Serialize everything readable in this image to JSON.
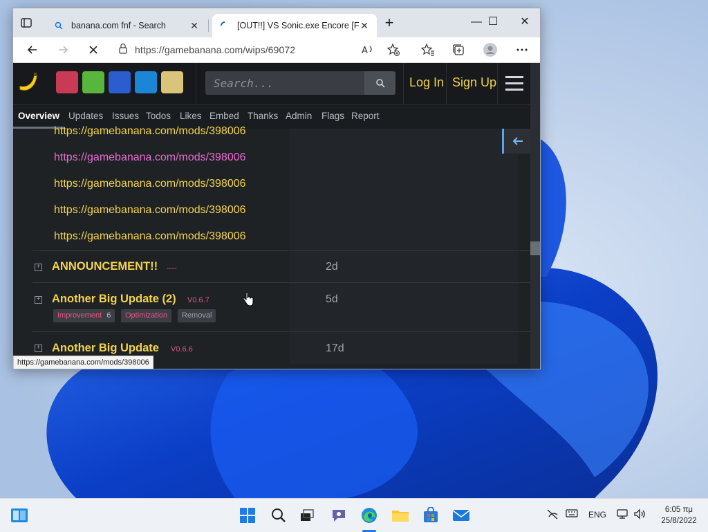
{
  "browser": {
    "tabs": [
      {
        "title": "banana.com fnf - Search",
        "favicon": "search-icon"
      },
      {
        "title": "[OUT!!] VS Sonic.exe Encore [FAN",
        "favicon": "loading-icon"
      }
    ],
    "address": "https://gamebanana.com/wips/69072",
    "status_url": "https://gamebanana.com/mods/398006"
  },
  "site": {
    "search_placeholder": "Search...",
    "login": "Log In",
    "signup": "Sign Up",
    "subnav": [
      "Overview",
      "Updates",
      "Issues",
      "Todos",
      "Likes",
      "Embed",
      "Thanks",
      "Admin",
      "Flags",
      "Report"
    ],
    "links": [
      {
        "text": "https://gamebanana.com/mods/398006",
        "color": "#f3d44a"
      },
      {
        "text": "https://gamebanana.com/mods/398006",
        "color": "#e86bd0"
      },
      {
        "text": "https://gamebanana.com/mods/398006",
        "color": "#f3d44a"
      },
      {
        "text": "https://gamebanana.com/mods/398006",
        "color": "#f3d44a"
      },
      {
        "text": "https://gamebanana.com/mods/398006",
        "color": "#f3d44a"
      }
    ],
    "updates": [
      {
        "title": "ANNOUNCEMENT!!",
        "version": "----",
        "age": "2d"
      },
      {
        "title": "Another Big Update (2)",
        "version": "V0.6.7",
        "age": "5d",
        "tags": [
          {
            "label": "Improvement",
            "count": "6"
          },
          {
            "label": "Optimization"
          },
          {
            "label": "Removal"
          }
        ]
      },
      {
        "title": "Another Big Update",
        "version": "V0.6.6",
        "age": "17d"
      }
    ]
  },
  "taskbar": {
    "language": "ENG",
    "time": "6:05 πμ",
    "date": "25/8/2022"
  },
  "colors": {
    "accent_yellow": "#f3d44a",
    "pink": "#e75480",
    "blue": "#5aa7e4"
  }
}
